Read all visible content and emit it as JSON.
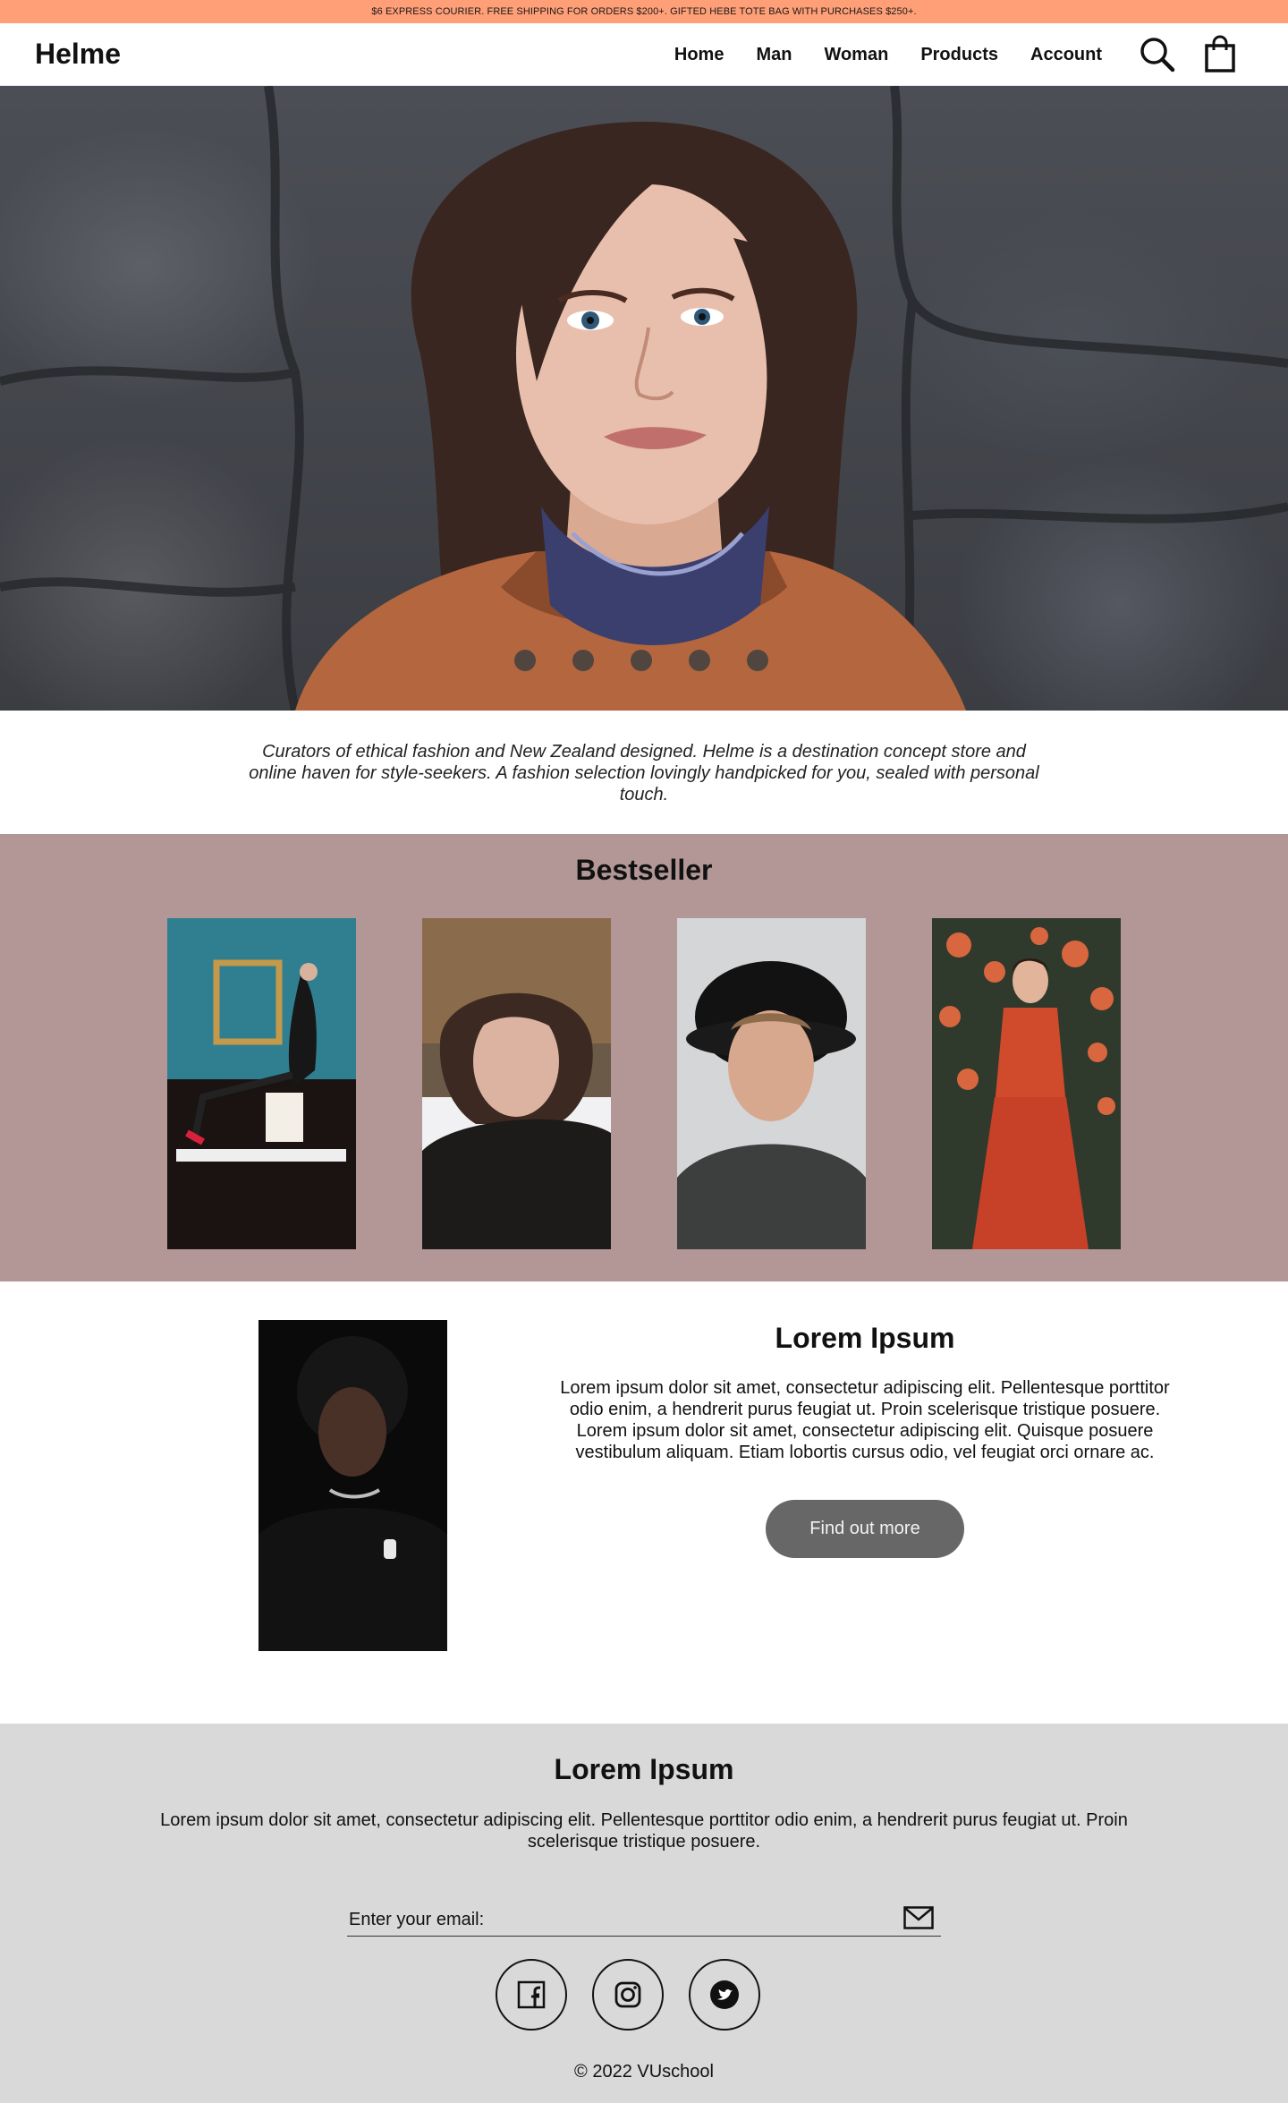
{
  "announcement": "$6 EXPRESS COURIER. FREE SHIPPING FOR ORDERS $200+. GIFTED HEBE TOTE BAG WITH PURCHASES $250+.",
  "header": {
    "logo": "Helme",
    "nav": [
      "Home",
      "Man",
      "Woman",
      "Products",
      "Account"
    ],
    "icons": [
      "search-icon",
      "shopping-bag-icon"
    ]
  },
  "hero": {
    "slides": 5,
    "active_slide": 1
  },
  "intro": "Curators of ethical fashion and New Zealand designed. Helme is a destination concept store and online haven for style-seekers. A fashion selection lovingly handpicked for you, sealed with personal touch.",
  "bestseller": {
    "title": "Bestseller",
    "items": [
      "woman-on-piano",
      "woman-black-top",
      "man-black-hat",
      "woman-red-dress"
    ]
  },
  "feature": {
    "title": "Lorem Ipsum",
    "text": "Lorem ipsum dolor sit amet, consectetur adipiscing elit. Pellentesque porttitor odio enim, a hendrerit purus feugiat ut. Proin scelerisque tristique posuere. Lorem ipsum dolor sit amet, consectetur adipiscing elit. Quisque posuere vestibulum aliquam. Etiam lobortis cursus odio, vel feugiat orci ornare ac.",
    "button": "Find out more"
  },
  "footer": {
    "title": "Lorem Ipsum",
    "text": "Lorem ipsum dolor sit amet, consectetur adipiscing elit. Pellentesque porttitor odio enim, a hendrerit purus feugiat ut. Proin scelerisque tristique posuere.",
    "email_label": "Enter your email:",
    "social": [
      "facebook-icon",
      "instagram-icon",
      "twitter-icon"
    ],
    "copyright": "© 2022 VUschool"
  },
  "colors": {
    "announcement_bg": "#ff9f77",
    "bestseller_bg": "#b39696",
    "footer_bg": "#d9d9d9",
    "button_bg": "#676767"
  }
}
